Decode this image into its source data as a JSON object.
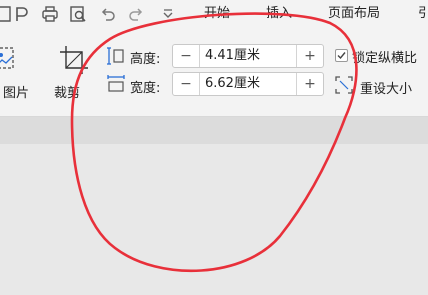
{
  "menu": {
    "tabs": [
      "开始",
      "插入",
      "页面布局",
      "引"
    ]
  },
  "ribbon": {
    "picture_label": "图片",
    "crop_label": "裁剪",
    "height": {
      "label": "高度:",
      "value": "4.41厘米",
      "minus": "−",
      "plus": "+"
    },
    "width": {
      "label": "宽度:",
      "value": "6.62厘米",
      "minus": "−",
      "plus": "+"
    },
    "lock_ratio_label": "锁定纵横比",
    "reset_size_label": "重设大小"
  },
  "colors": {
    "annotation": "#e8303a",
    "accent_blue": "#2b6fd6"
  }
}
